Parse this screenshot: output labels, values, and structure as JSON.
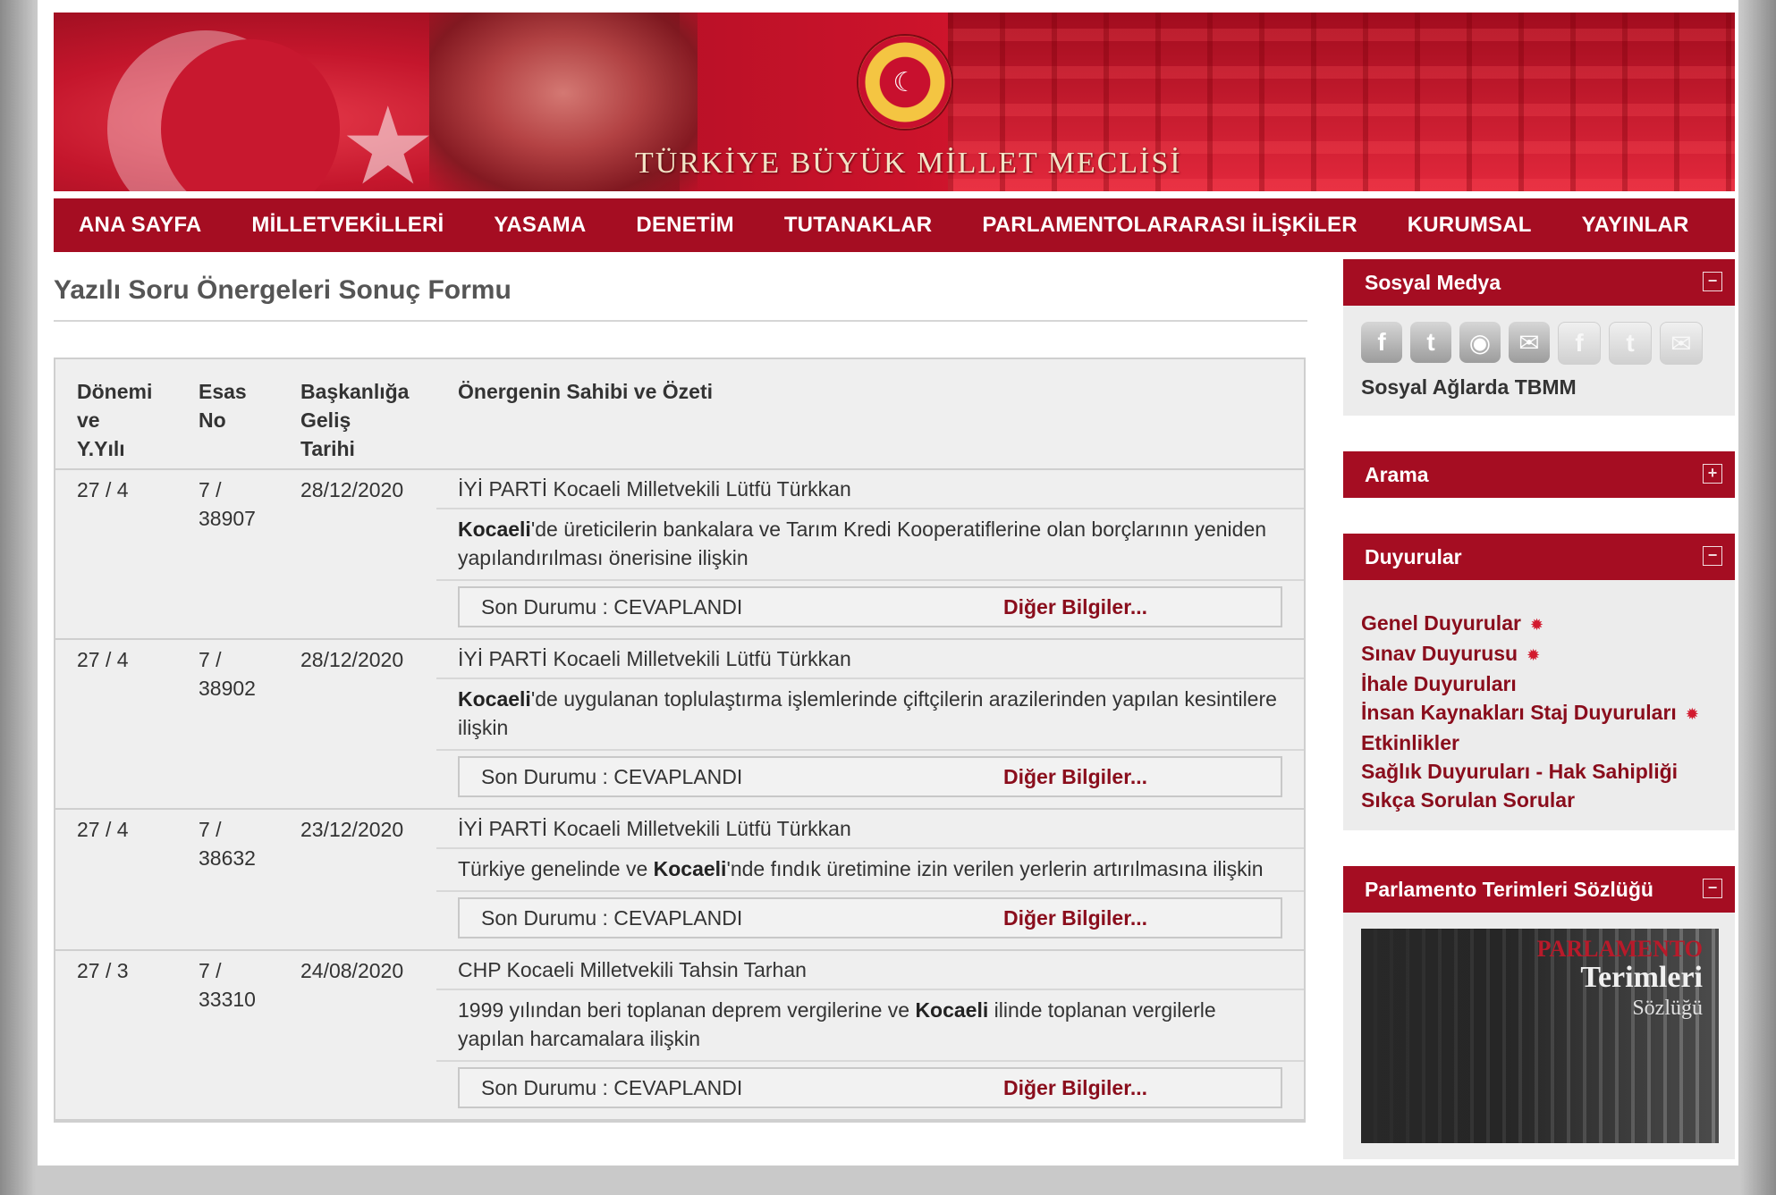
{
  "banner": {
    "title": "TÜRKİYE BÜYÜK MİLLET MECLİSİ",
    "emblem_glyph": "☾"
  },
  "nav": [
    "ANA SAYFA",
    "MİLLETVEKİLLERİ",
    "YASAMA",
    "DENETİM",
    "TUTANAKLAR",
    "PARLAMENTOLARARASI İLİŞKİLER",
    "KURUMSAL",
    "YAYINLAR"
  ],
  "page_title": "Yazılı Soru Önergeleri Sonuç Formu",
  "table": {
    "headers": {
      "donem": [
        "Dönemi",
        "ve",
        "Y.Yılı"
      ],
      "esas": [
        "Esas",
        "No"
      ],
      "tarih": [
        "Başkanlığa",
        "Geliş",
        "Tarihi"
      ],
      "ozet": "Önergenin Sahibi ve Özeti"
    },
    "rows": [
      {
        "donem": "27 / 4",
        "esas_a": "7 /",
        "esas_b": "38907",
        "tarih": "28/12/2020",
        "owner": "İYİ PARTİ Kocaeli Milletvekili Lütfü Türkkan",
        "summary_pre": "",
        "summary_bold": "Kocaeli",
        "summary_post": "'de üreticilerin bankalara ve Tarım Kredi Kooperatiflerine olan borçlarının yeniden yapılandırılması önerisine ilişkin",
        "status": "Son Durumu : CEVAPLANDI",
        "link": "Diğer Bilgiler..."
      },
      {
        "donem": "27 / 4",
        "esas_a": "7 /",
        "esas_b": "38902",
        "tarih": "28/12/2020",
        "owner": "İYİ PARTİ Kocaeli Milletvekili Lütfü Türkkan",
        "summary_pre": "",
        "summary_bold": "Kocaeli",
        "summary_post": "'de uygulanan toplulaştırma işlemlerinde çiftçilerin arazilerinden yapılan kesintilere ilişkin",
        "status": "Son Durumu : CEVAPLANDI",
        "link": "Diğer Bilgiler..."
      },
      {
        "donem": "27 / 4",
        "esas_a": "7 /",
        "esas_b": "38632",
        "tarih": "23/12/2020",
        "owner": "İYİ PARTİ Kocaeli Milletvekili Lütfü Türkkan",
        "summary_pre": "Türkiye genelinde ve ",
        "summary_bold": "Kocaeli",
        "summary_post": "'nde fındık üretimine izin verilen yerlerin artırılmasına ilişkin",
        "status": "Son Durumu : CEVAPLANDI",
        "link": "Diğer Bilgiler..."
      },
      {
        "donem": "27 / 3",
        "esas_a": "7 /",
        "esas_b": "33310",
        "tarih": "24/08/2020",
        "owner": "CHP Kocaeli Milletvekili Tahsin Tarhan",
        "summary_pre": "1999 yılından beri toplanan deprem vergilerine ve ",
        "summary_bold": "Kocaeli",
        "summary_post": " ilinde toplanan vergilerle yapılan harcamalara ilişkin",
        "status": "Son Durumu : CEVAPLANDI",
        "link": "Diğer Bilgiler..."
      }
    ]
  },
  "sidebar": {
    "social": {
      "title": "Sosyal Medya",
      "toggle": "−",
      "icons": [
        "facebook-icon",
        "twitter-icon",
        "rss-icon",
        "mail-icon",
        "facebook-icon",
        "twitter-icon",
        "mail-icon"
      ],
      "icon_glyphs": [
        "f",
        "t",
        "◉",
        "✉",
        "f",
        "t",
        "✉"
      ],
      "caption": "Sosyal Ağlarda TBMM"
    },
    "search": {
      "title": "Arama",
      "toggle": "+"
    },
    "announcements": {
      "title": "Duyurular",
      "toggle": "−",
      "items": [
        {
          "label": "Genel Duyurular",
          "new": true
        },
        {
          "label": "Sınav Duyurusu",
          "new": true
        },
        {
          "label": "İhale Duyuruları",
          "new": false
        },
        {
          "label": "İnsan Kaynakları Staj Duyuruları",
          "new": true
        },
        {
          "label": "Etkinlikler",
          "new": false
        },
        {
          "label": "Sağlık Duyuruları - Hak Sahipliği",
          "new": false
        },
        {
          "label": "Sıkça Sorulan Sorular",
          "new": false
        }
      ],
      "new_glyph": "✹"
    },
    "dictionary": {
      "title": "Parlamento Terimleri Sözlüğü",
      "toggle": "−",
      "image_text": [
        "PARLAMENTO",
        "Terimleri",
        "Sözlüğü"
      ]
    }
  }
}
